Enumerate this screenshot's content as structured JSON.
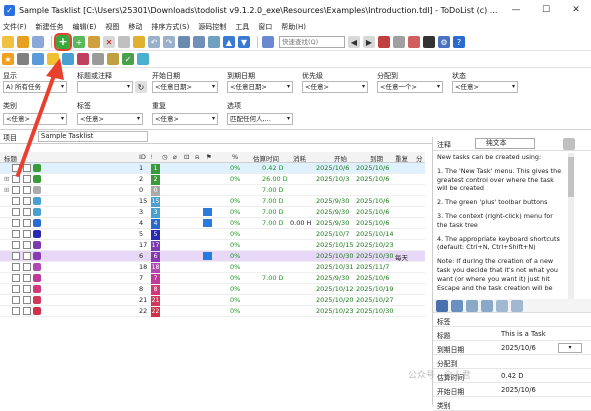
{
  "window": {
    "title": "Sample Tasklist [C:\\Users\\25301\\Downloads\\todolist v9.1.2.0_exe\\Resources\\Examples\\Introduction.tdl] - ToDoList (c) ...",
    "min": "—",
    "max": "☐",
    "close": "✕"
  },
  "menu": [
    "文件(F)",
    "新建任务",
    "编辑(E)",
    "视图",
    "移动",
    "排序方式(S)",
    "源码控制",
    "工具",
    "窗口",
    "帮助(H)"
  ],
  "toolbar": {
    "find_placeholder": "快速查找(Q)"
  },
  "filters": {
    "show_label": "显示",
    "show_value": "A) 所有任务",
    "title_label": "标题或注释",
    "title_value": "",
    "start_label": "开始日期",
    "start_value": "<任意日期>",
    "due_label": "到期日期",
    "due_value": "<任意日期>",
    "priority_label": "优先级",
    "priority_value": "<任意>",
    "alloc_label": "分配到",
    "alloc_value": "<任意一个>",
    "status_label": "状态",
    "status_value": "<任意>",
    "category_label": "类别",
    "category_value": "<任意>",
    "tags_label": "标签",
    "tags_value": "<任意>",
    "recur_label": "重复",
    "recur_value": "<任意>",
    "options_label": "选项",
    "options_value": "匹配任何人,..."
  },
  "project": {
    "label": "项目",
    "value": "Sample Tasklist"
  },
  "columns": {
    "title": "标题",
    "id": "ID",
    "pct": "%",
    "est": "估算时间",
    "spent": "消耗",
    "start": "开始",
    "due": "到期",
    "recur": "重复",
    "alloc": "分"
  },
  "tasks": [
    {
      "title": "This is a Task",
      "extra": "New tasks c...",
      "id": "1",
      "pct": "0%",
      "est": "0.42 D",
      "spent": "",
      "start": "2025/10/6",
      "due": "2025/10/6",
      "recur": "",
      "color": "#1a8a1a",
      "idx_color": "#3a9a3a",
      "bg": "#dff0ff"
    },
    {
      "title": "A Task can contain...",
      "extra": "",
      "id": "2",
      "pct": "0%",
      "est": "26.00 D",
      "spent": "",
      "start": "2025/10/3",
      "due": "2025/10/6",
      "recur": "",
      "color": "#1a8a1a",
      "idx_color": "#3a9a3a",
      "bg": "#fff"
    },
    {
      "title": "This is a completed task",
      "extra": "A...",
      "id": "0",
      "pct": "",
      "est": "7.00 D",
      "spent": "",
      "start": "",
      "due": "",
      "recur": "",
      "color": "#9a9a9a",
      "idx_color": "#aaaaaa",
      "bg": "#fff"
    },
    {
      "title": "Adding Comments to Tasks",
      "extra": "",
      "id": "15",
      "pct": "0%",
      "est": "7.00 D",
      "spent": "",
      "start": "2025/9/30",
      "due": "2025/10/6",
      "recur": "",
      "color": "#4a7fb0",
      "idx_color": "#4aa0d0",
      "bg": "#fff"
    },
    {
      "title": "Colouring Tasks",
      "extra": "Tasks ca...",
      "id": "3",
      "pct": "0%",
      "est": "7.00 D",
      "spent": "",
      "start": "2025/9/30",
      "due": "2025/10/6",
      "recur": "",
      "color": "#4a7fb0",
      "idx_color": "#4aa0d0",
      "bg": "#fff"
    },
    {
      "title": "Categorizing Tasks",
      "extra": "To ad...",
      "id": "4",
      "pct": "0%",
      "est": "7.00 D",
      "spent": "0.00 H",
      "start": "2025/9/30",
      "due": "2025/10/6",
      "recur": "",
      "color": "#3a6ab0",
      "idx_color": "#2a6ad0",
      "bg": "#fff"
    },
    {
      "title": "Likewise for the task's St...",
      "extra": "",
      "id": "5",
      "pct": "0%",
      "est": "",
      "spent": "",
      "start": "2025/10/7",
      "due": "2025/10/14",
      "recur": "",
      "color": "#2a2ab0",
      "idx_color": "#2a2ab0",
      "bg": "#fff"
    },
    {
      "title": "Associated Files with Tasks",
      "extra": "",
      "id": "17",
      "pct": "0%",
      "est": "",
      "spent": "",
      "start": "2025/10/15",
      "due": "2025/10/23",
      "recur": "",
      "color": "#7a3ab0",
      "idx_color": "#7a3ab0",
      "bg": "#fff"
    },
    {
      "title": "Navigating the Tasklist",
      "extra": "T...",
      "id": "6",
      "pct": "0%",
      "est": "",
      "spent": "",
      "start": "2025/10/30",
      "due": "2025/10/30",
      "recur": "每天",
      "color": "#6a2a9a",
      "idx_color": "#8a3ab0",
      "bg": "#e8d8f8"
    },
    {
      "title": "Filtering Tasks",
      "extra": "Once you h...",
      "id": "18",
      "pct": "0%",
      "est": "",
      "spent": "",
      "start": "2025/10/31",
      "due": "2025/11/7",
      "recur": "",
      "color": "#9a3ab0",
      "idx_color": "#b04ab0",
      "bg": "#fff"
    },
    {
      "title": "Importing Tasks",
      "extra": "ToDoList...",
      "id": "7",
      "pct": "0%",
      "est": "7.00 D",
      "spent": "",
      "start": "2025/9/30",
      "due": "2025/10/6",
      "recur": "",
      "color": "#b02a8a",
      "idx_color": "#c03a9a",
      "bg": "#fff"
    },
    {
      "title": "Exporting Tasks",
      "extra": "ToDoList ...",
      "id": "8",
      "pct": "0%",
      "est": "",
      "spent": "",
      "start": "2025/10/12",
      "due": "2025/10/19",
      "recur": "",
      "color": "#c02a6a",
      "idx_color": "#d03a7a",
      "bg": "#fff"
    },
    {
      "title": "Sharing Tasklists",
      "extra": "If you w...",
      "id": "21",
      "pct": "0%",
      "est": "",
      "spent": "",
      "start": "2025/10/20",
      "due": "2025/10/27",
      "recur": "",
      "color": "#c02a4a",
      "idx_color": "#d03a5a",
      "bg": "#fff"
    },
    {
      "title": "Getting Help",
      "extra": "There are a ...",
      "id": "22",
      "pct": "0%",
      "est": "",
      "spent": "",
      "start": "2025/10/23",
      "due": "2025/10/30",
      "recur": "",
      "color": "#c0203a",
      "idx_color": "#d0304a",
      "bg": "#fff"
    }
  ],
  "notes": {
    "label": "注释",
    "format": "纯文本",
    "paragraphs": [
      "New tasks can be created using:",
      "1. The 'New Task' menu. This gives the greatest control over where the task will be created",
      "2. The green 'plus' toolbar buttons",
      "3. The context (right-click) menu for the task tree",
      "4. The appropriate keyboard shortcuts (default: Ctrl+N, Ctrl+Shift+N)",
      "Note: If during the creation of a new task you decide that it's not what you want (or where you want it) just hit Escape and the task creation will be"
    ]
  },
  "props": [
    {
      "k": "标签",
      "v": ""
    },
    {
      "k": "标题",
      "v": "This is a Task"
    },
    {
      "k": "到期日期",
      "v": "2025/10/6"
    },
    {
      "k": "分配到",
      "v": ""
    },
    {
      "k": "估算时间",
      "v": "0.42 D"
    },
    {
      "k": "开始日期",
      "v": "2025/10/6"
    },
    {
      "k": "类别",
      "v": ""
    }
  ],
  "watermark": "公众号 · 伞十君"
}
